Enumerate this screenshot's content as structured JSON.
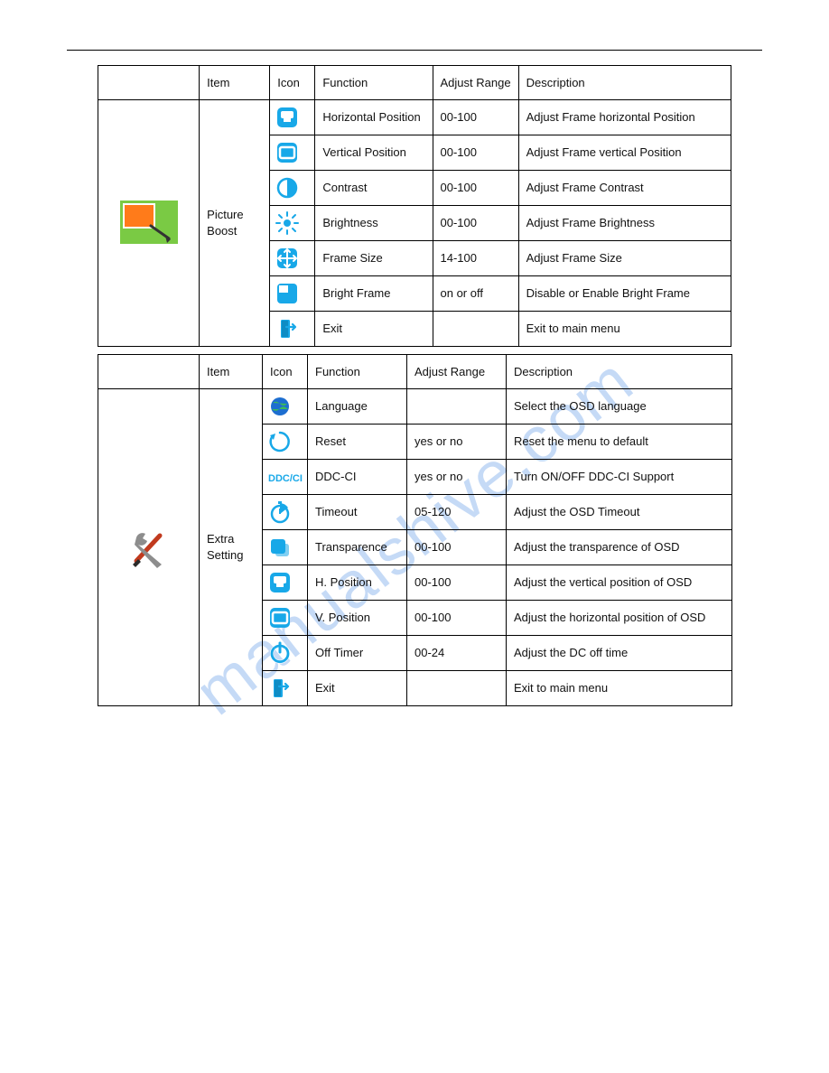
{
  "watermark": "manualshive.com",
  "table1": {
    "headers": {
      "item": "Item",
      "icon": "Icon",
      "function": "Function",
      "range": "Adjust Range",
      "desc": "Description"
    },
    "category": "Picture Boost",
    "rows": [
      {
        "icon": "hpos",
        "func": "Horizontal Position",
        "range": "00-100",
        "desc": "Adjust Frame horizontal Position"
      },
      {
        "icon": "vpos",
        "func": "Vertical Position",
        "range": "00-100",
        "desc": "Adjust Frame vertical Position"
      },
      {
        "icon": "contrast",
        "func": "Contrast",
        "range": "00-100",
        "desc": "Adjust Frame Contrast"
      },
      {
        "icon": "brightness",
        "func": "Brightness",
        "range": "00-100",
        "desc": "Adjust Frame Brightness"
      },
      {
        "icon": "framesize",
        "func": "Frame Size",
        "range": "14-100",
        "desc": "Adjust Frame Size"
      },
      {
        "icon": "brightfrm",
        "func": "Bright Frame",
        "range": "on or off",
        "desc": "Disable or Enable Bright Frame"
      },
      {
        "icon": "exit",
        "func": "Exit",
        "range": "",
        "desc": "Exit to main menu"
      }
    ]
  },
  "table2": {
    "headers": {
      "item": "Item",
      "icon": "Icon",
      "function": "Function",
      "range": "Adjust Range",
      "desc": "Description"
    },
    "category": "Extra Setting",
    "rows": [
      {
        "icon": "globe",
        "func": "Language",
        "range": "",
        "desc": "Select the OSD language"
      },
      {
        "icon": "reset",
        "func": "Reset",
        "range": "yes or no",
        "desc": "Reset the menu to default"
      },
      {
        "icon": "ddcci",
        "func": "DDC-CI",
        "range": "yes or no",
        "desc": "Turn ON/OFF DDC-CI Support"
      },
      {
        "icon": "timeout",
        "func": "Timeout",
        "range": "05-120",
        "desc": "Adjust the OSD Timeout"
      },
      {
        "icon": "transp",
        "func": "Transparence",
        "range": "00-100",
        "desc": "Adjust the transparence of OSD"
      },
      {
        "icon": "hpos",
        "func": "H. Position",
        "range": "00-100",
        "desc": "Adjust the vertical position of OSD"
      },
      {
        "icon": "vpos",
        "func": "V. Position",
        "range": "00-100",
        "desc": "Adjust the horizontal position of OSD"
      },
      {
        "icon": "power",
        "func": "Off Timer",
        "range": "00-24",
        "desc": "Adjust the DC off time"
      },
      {
        "icon": "exit",
        "func": "Exit",
        "range": "",
        "desc": "Exit to main menu"
      }
    ]
  }
}
